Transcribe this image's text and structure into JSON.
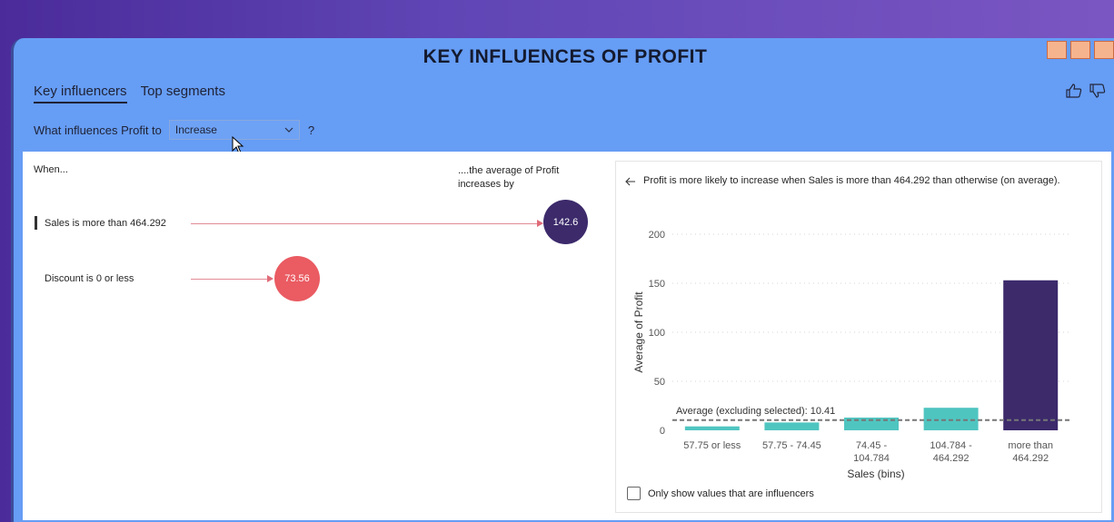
{
  "title": "KEY INFLUENCES OF PROFIT",
  "tabs": [
    {
      "label": "Key influencers",
      "active": true
    },
    {
      "label": "Top segments",
      "active": false
    }
  ],
  "question": {
    "prefix": "What influences Profit to",
    "selected": "Increase",
    "suffix": "?"
  },
  "influencers_panel": {
    "when_header": "When...",
    "avg_header_line1": "....the average of Profit",
    "avg_header_line2": "increases by",
    "items": [
      {
        "label": "Sales is more than 464.292",
        "value": "142.6",
        "color": "#3c2a6b",
        "selected": true
      },
      {
        "label": "Discount is 0 or less",
        "value": "73.56",
        "color": "#ea5b62",
        "selected": false
      }
    ]
  },
  "detail": {
    "back_icon": "arrow-left-icon",
    "description": "Profit is more likely to increase when Sales is more than 464.292 than otherwise (on average).",
    "checkbox_label": "Only show values that are influencers",
    "checkbox_checked": false
  },
  "chart_data": {
    "type": "bar",
    "ylabel": "Average of Profit",
    "xlabel": "Sales (bins)",
    "yticks": [
      0,
      50,
      100,
      150,
      200
    ],
    "ylim": [
      0,
      200
    ],
    "categories": [
      "57.75 or less",
      "57.75 - 74.45",
      "74.45 - 104.784",
      "104.784 - 464.292",
      "more than 464.292"
    ],
    "category_lines": [
      [
        "57.75 or less"
      ],
      [
        "57.75 - 74.45"
      ],
      [
        "74.45 -",
        "104.784"
      ],
      [
        "104.784 -",
        "464.292"
      ],
      [
        "more than",
        "464.292"
      ]
    ],
    "values": [
      4,
      8,
      13,
      23,
      153
    ],
    "bar_colors": [
      "#4fc5c0",
      "#4fc5c0",
      "#4fc5c0",
      "#4fc5c0",
      "#3c2a6b"
    ],
    "average_line": {
      "value": 10.41,
      "label": "Average (excluding selected): 10.41"
    }
  },
  "colors": {
    "panel_bg": "#669df5",
    "accent_dark": "#3c2a6b",
    "accent_red": "#ea5b62",
    "teal": "#4fc5c0"
  }
}
